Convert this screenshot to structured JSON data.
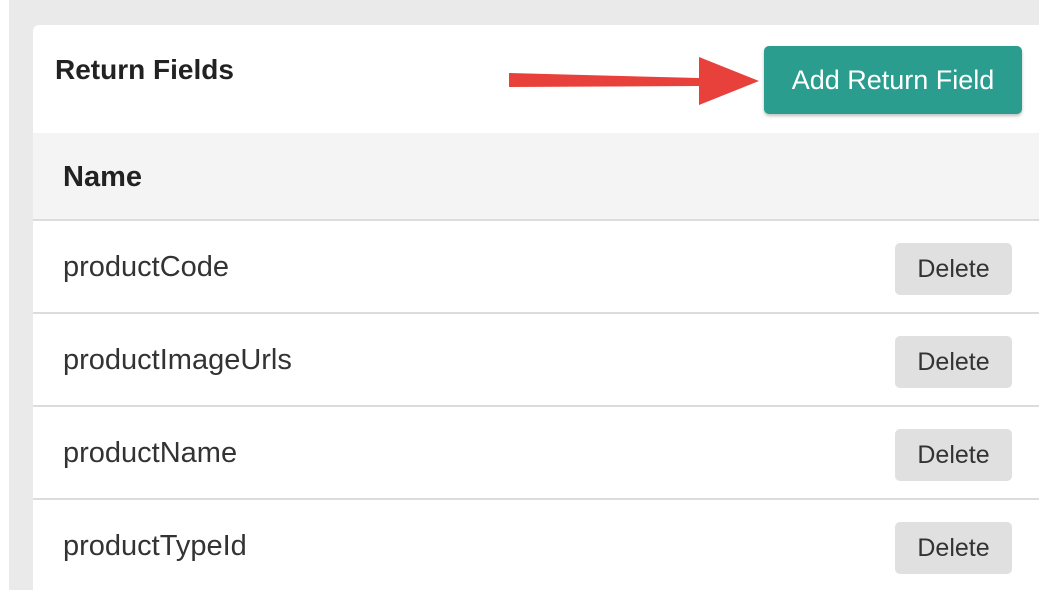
{
  "return_fields": {
    "title": "Return Fields",
    "add_button_label": "Add Return Field",
    "column_header": "Name",
    "rows": [
      {
        "name": "productCode",
        "action": "Delete"
      },
      {
        "name": "productImageUrls",
        "action": "Delete"
      },
      {
        "name": "productName",
        "action": "Delete"
      },
      {
        "name": "productTypeId",
        "action": "Delete"
      }
    ]
  },
  "colors": {
    "accent": "#2a9d8f",
    "annotation_arrow": "#e8403a",
    "delete_button_bg": "#e0e0e0",
    "backdrop": "#eaeaea"
  },
  "icons": {
    "annotation": "red-arrow-icon"
  }
}
